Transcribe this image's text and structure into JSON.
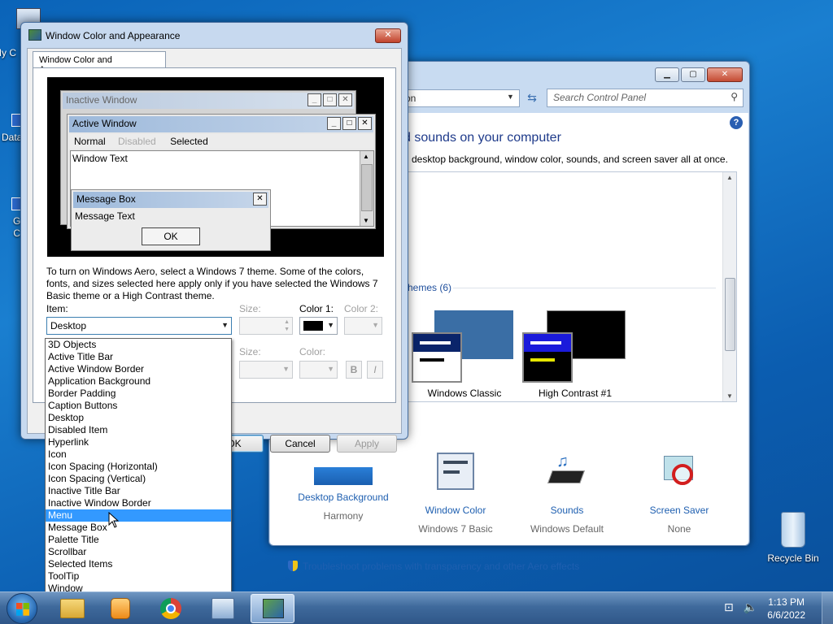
{
  "desktop": {
    "icons": [
      {
        "label": "My C"
      },
      {
        "label": "Data"
      },
      {
        "label": "G\nC"
      },
      {
        "label": "Recycle Bin"
      }
    ]
  },
  "control_panel": {
    "address_text": "on",
    "search_placeholder": "Search Control Panel",
    "heading": "d sounds on your computer",
    "subtext": "desktop background, window color, sounds, and screen saver all at once.",
    "theme_group": "hemes (6)",
    "themes": [
      {
        "label": "Windows Classic"
      },
      {
        "label": "High Contrast #1"
      }
    ],
    "items": [
      {
        "title": "Desktop Background",
        "sub": "Harmony"
      },
      {
        "title": "Window Color",
        "sub": "Windows 7 Basic"
      },
      {
        "title": "Sounds",
        "sub": "Windows Default"
      },
      {
        "title": "Screen Saver",
        "sub": "None"
      }
    ],
    "troubleshoot": "Troubleshoot problems with transparency and other Aero effects"
  },
  "dialog": {
    "title": "Window Color and Appearance",
    "tab": "Window Color and Appearance",
    "preview": {
      "inactive_title": "Inactive Window",
      "active_title": "Active Window",
      "menu_normal": "Normal",
      "menu_disabled": "Disabled",
      "menu_selected": "Selected",
      "window_text": "Window Text",
      "message_box_title": "Message Box",
      "message_text": "Message Text",
      "ok": "OK"
    },
    "description": "To turn on Windows Aero, select a Windows 7 theme.  Some of the colors, fonts, and sizes selected here apply only if you have selected the Windows 7 Basic theme or a High Contrast theme.",
    "item_label": "Item:",
    "item_value": "Desktop",
    "size_label": "Size:",
    "color1_label": "Color 1:",
    "color2_label": "Color 2:",
    "font_size_label": "Size:",
    "font_color_label": "Color:",
    "bold_label": "B",
    "italic_label": "I",
    "ok_button": "OK",
    "cancel_button": "Cancel",
    "apply_button": "Apply",
    "item_options": [
      "3D Objects",
      "Active Title Bar",
      "Active Window Border",
      "Application Background",
      "Border Padding",
      "Caption Buttons",
      "Desktop",
      "Disabled Item",
      "Hyperlink",
      "Icon",
      "Icon Spacing (Horizontal)",
      "Icon Spacing (Vertical)",
      "Inactive Title Bar",
      "Inactive Window Border",
      "Menu",
      "Message Box",
      "Palette Title",
      "Scrollbar",
      "Selected Items",
      "ToolTip",
      "Window"
    ],
    "highlighted_option": "Menu"
  },
  "taskbar": {
    "time": "1:13 PM",
    "date": "6/6/2022"
  }
}
